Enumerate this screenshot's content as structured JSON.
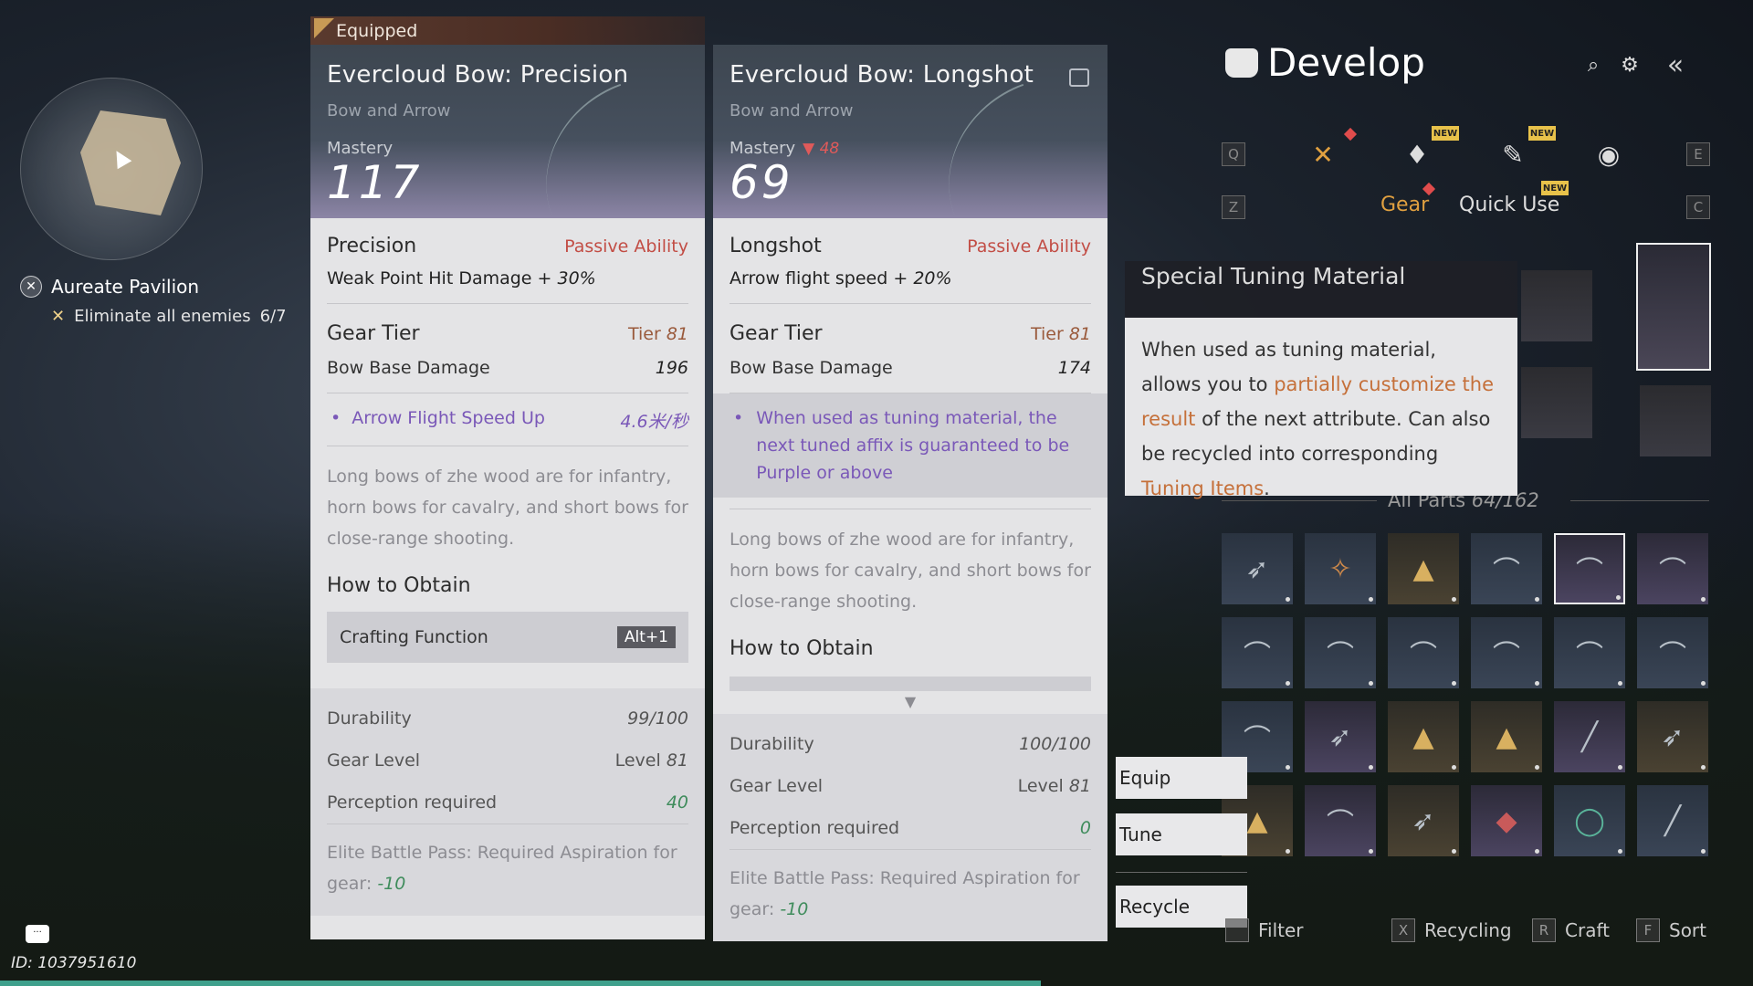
{
  "minimap": {
    "icon": "map-marker-icon"
  },
  "quest": {
    "title": "Aureate Pavilion",
    "objective": "Eliminate all enemies",
    "progress": "6/7"
  },
  "player_id": "ID: 1037951610",
  "left_card": {
    "tag": "Equipped",
    "name": "Evercloud Bow: Precision",
    "category": "Bow and Arrow",
    "mastery_label": "Mastery",
    "mastery": "117",
    "ability_name": "Precision",
    "ability_type": "Passive Ability",
    "ability_desc_prefix": "Weak Point Hit Damage + ",
    "ability_desc_value": "30%",
    "gear_tier_label": "Gear Tier",
    "gear_tier_prefix": "Tier ",
    "gear_tier_value": "81",
    "base_damage_label": "Bow Base Damage",
    "base_damage": "196",
    "affix_name": "Arrow Flight Speed Up",
    "affix_value": "4.6米/秒",
    "lore": "Long bows of zhe wood are for infantry, horn bows for cavalry, and short bows for close-range shooting.",
    "obtain_title": "How to Obtain",
    "obtain_method": "Crafting Function",
    "obtain_key": "Alt+1",
    "durability_label": "Durability",
    "durability": "99/100",
    "gear_level_label": "Gear Level",
    "gear_level_prefix": "Level ",
    "gear_level_value": "81",
    "perception_label": "Perception required",
    "perception": "40",
    "pass_text": "Elite Battle Pass: Required Aspiration for gear: ",
    "pass_value": "-10"
  },
  "right_card": {
    "name": "Evercloud Bow: Longshot",
    "category": "Bow and Arrow",
    "mastery_label": "Mastery",
    "mastery_diff": "48",
    "mastery": "69",
    "ability_name": "Longshot",
    "ability_type": "Passive Ability",
    "ability_desc_prefix": "Arrow flight speed + ",
    "ability_desc_value": "20%",
    "gear_tier_label": "Gear Tier",
    "gear_tier_prefix": "Tier ",
    "gear_tier_value": "81",
    "base_damage_label": "Bow Base Damage",
    "base_damage": "174",
    "affix_text": "When used as tuning material, the next tuned affix is guaranteed to be Purple or above",
    "lore": "Long bows of zhe wood are for infantry, horn bows for cavalry, and short bows for close-range shooting.",
    "obtain_title": "How to Obtain",
    "durability_label": "Durability",
    "durability": "100/100",
    "gear_level_label": "Gear Level",
    "gear_level_prefix": "Level ",
    "gear_level_value": "81",
    "perception_label": "Perception required",
    "perception": "0",
    "pass_text": "Elite Battle Pass: Required Aspiration for gear: ",
    "pass_value": "-10"
  },
  "develop": {
    "title": "Develop",
    "key_q": "Q",
    "key_e": "E",
    "key_z": "Z",
    "key_c": "C",
    "new_label": "NEW",
    "tab_gear": "Gear",
    "tab_quick_use": "Quick Use",
    "parts_label": "All Parts ",
    "parts_count": "64/162"
  },
  "tooltip": {
    "title": "Special Tuning Material",
    "text_1": "When used as tuning material, allows you to ",
    "highlight_1": "partially customize the result",
    "text_2": " of the next attribute. Can also be recycled into corresponding ",
    "highlight_2": "Tuning Items",
    "text_3": "."
  },
  "actions": {
    "equip": "Equip",
    "tune": "Tune",
    "recycle": "Recycle"
  },
  "hints": {
    "filter": "Filter",
    "recycling_key": "X",
    "recycling": "Recycling",
    "craft_key": "R",
    "craft": "Craft",
    "sort_key": "F",
    "sort": "Sort"
  },
  "colors": {
    "accent_orange": "#e0a040",
    "passive_red": "#c24d45",
    "affix_purple": "#7a58b8",
    "value_green": "#3f8c5c"
  }
}
